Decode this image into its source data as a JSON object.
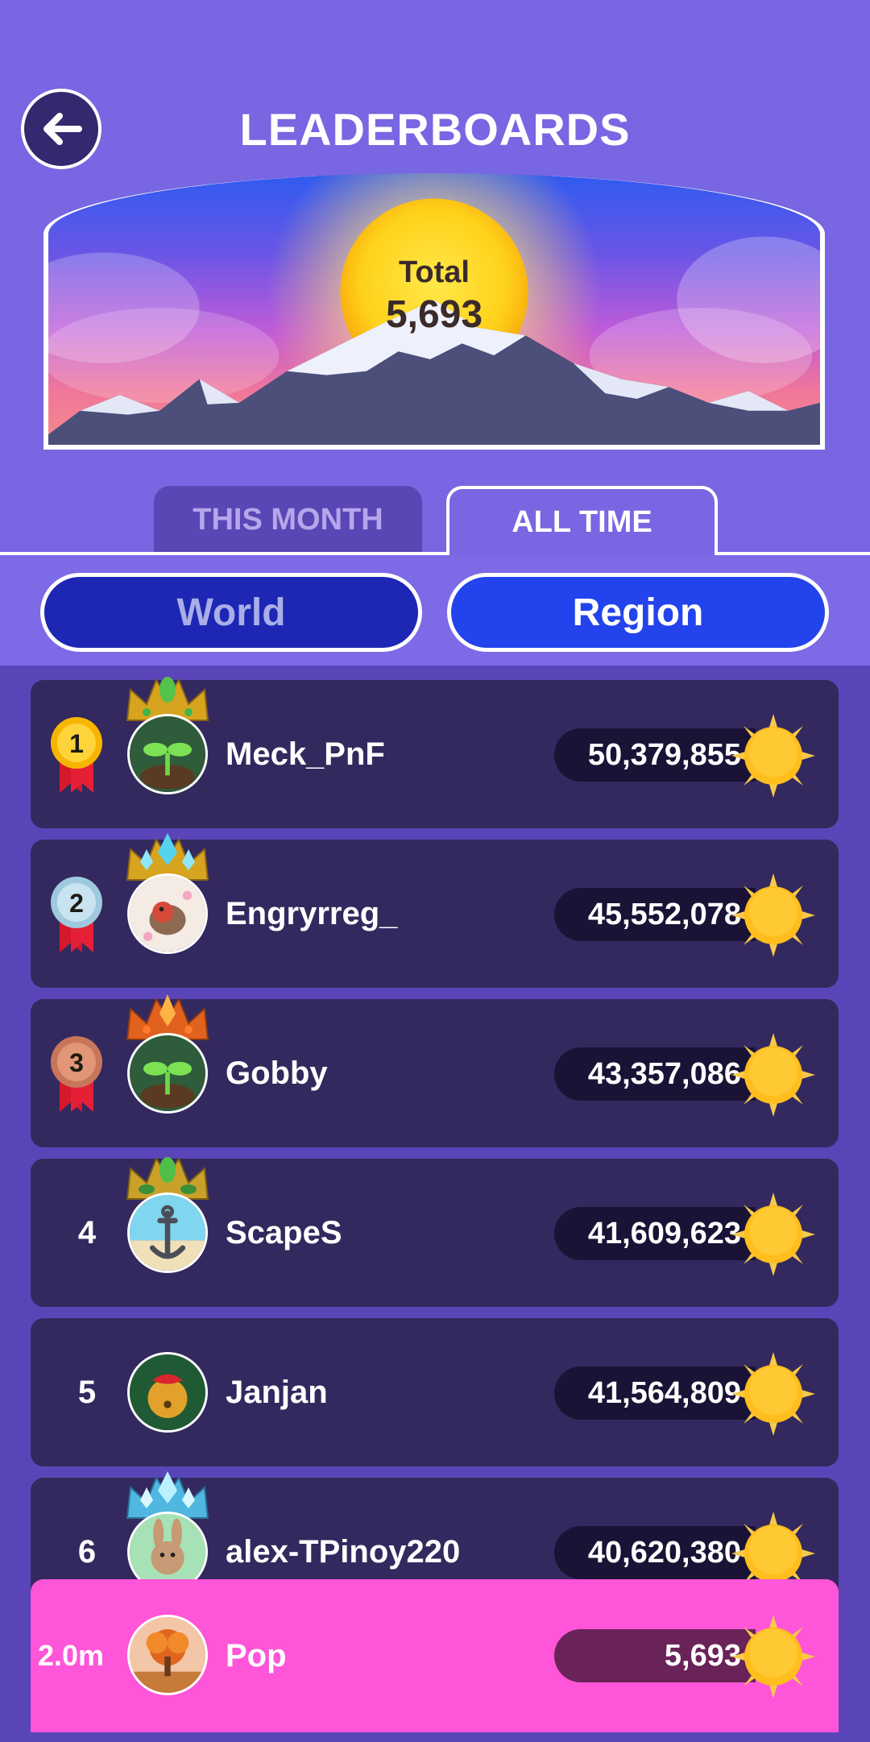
{
  "header": {
    "title": "LEADERBOARDS",
    "back_icon": "back-arrow-icon"
  },
  "banner": {
    "total_label": "Total",
    "total_value": "5,693"
  },
  "tabs": [
    {
      "label": "THIS MONTH",
      "active": false
    },
    {
      "label": "ALL TIME",
      "active": true
    }
  ],
  "filters": [
    {
      "label": "World",
      "active": false
    },
    {
      "label": "Region",
      "active": true
    }
  ],
  "colors": {
    "accent_pink": "#ff55d8",
    "panel_purple": "#7866e2",
    "row_dark": "#33295e"
  },
  "rows": [
    {
      "rank": "1",
      "name": "Meck_PnF",
      "score": "50,379,855",
      "medal": "gold"
    },
    {
      "rank": "2",
      "name": "Engryrreg_",
      "score": "45,552,078",
      "medal": "silver"
    },
    {
      "rank": "3",
      "name": "Gobby",
      "score": "43,357,086",
      "medal": "bronze"
    },
    {
      "rank": "4",
      "name": "ScapeS",
      "score": "41,609,623"
    },
    {
      "rank": "5",
      "name": "Janjan",
      "score": "41,564,809"
    },
    {
      "rank": "6",
      "name": "alex-TPinoy220",
      "score": "40,620,380"
    }
  ],
  "self_row": {
    "rank": "2.0m",
    "name": "Pop",
    "score": "5,693"
  }
}
